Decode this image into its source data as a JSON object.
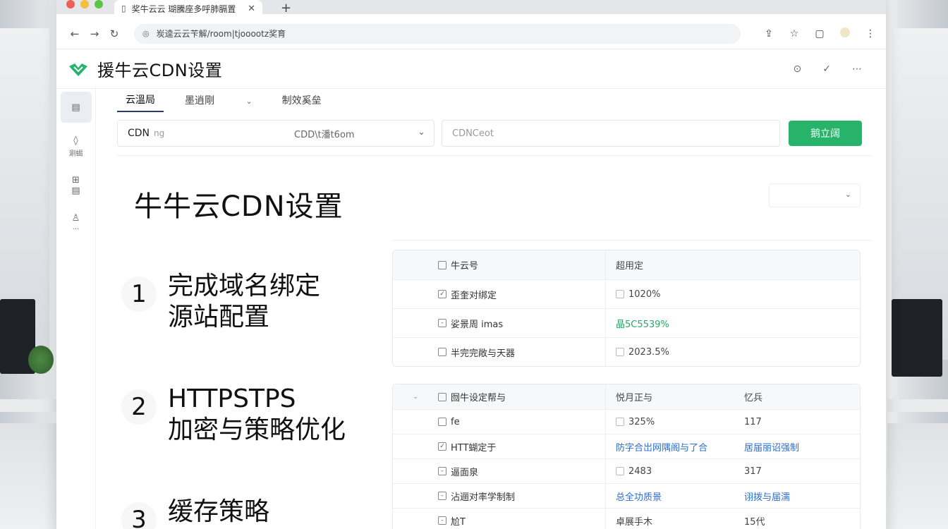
{
  "browser": {
    "tab_title": "奖牛云云  瑚騰座多呼肺膈置",
    "url": "炭逵云云苄解/room|tjooootz奖育",
    "new_tab_symbol": "+"
  },
  "app": {
    "title": "援牛云CDN设置"
  },
  "sidebar": {
    "items": [
      {
        "label": ""
      },
      {
        "label": "涮蝎"
      },
      {
        "label": ""
      },
      {
        "label": ""
      }
    ]
  },
  "tabs": [
    {
      "label": "云溫局"
    },
    {
      "label": "墨逍剛"
    },
    {
      "label": "制效奚垒"
    }
  ],
  "filter": {
    "cdn_label": "CDN",
    "cdn_sub": "ng",
    "cdn_select": "CDD\\t潘t6om",
    "input_placeholder": "CDNCeot",
    "confirm_button": "鹅立阔"
  },
  "heading": "牛牛云CDN设置",
  "steps": [
    {
      "num": "1",
      "line1": "完成域名绑定",
      "line2": "源站配置"
    },
    {
      "num": "2",
      "line1": "HTTPSTPS",
      "line2": "加密与策略优化"
    },
    {
      "num": "3",
      "line1": "缓存策略",
      "line2": ""
    }
  ],
  "table1": {
    "header": [
      "牛云号",
      "超用定"
    ],
    "rows": [
      [
        "歪奎对绑定",
        "1020%"
      ],
      [
        "娑景周   imas",
        "晶5C5539%"
      ],
      [
        "半完完敞与天器",
        "2023.5%"
      ]
    ]
  },
  "table2": {
    "header": [
      "囫牛设定帮与",
      "悦月正与",
      "忆兵"
    ],
    "rows": [
      [
        "fe",
        "325%",
        "117"
      ],
      [
        "HTT蝴定于",
        "防字合岀网隅阁与了合",
        "居届丽诏强制"
      ],
      [
        "逼面泉",
        "2483",
        "317"
      ],
      [
        "沾逦对率学制制",
        "总全功质景",
        "诩拨与届濡"
      ],
      [
        "尬T",
        "卓展手木",
        "15代"
      ]
    ]
  },
  "colors": {
    "accent_green": "#27b46a",
    "link_blue": "#2c6ccf",
    "logo_green": "#25b36a"
  }
}
